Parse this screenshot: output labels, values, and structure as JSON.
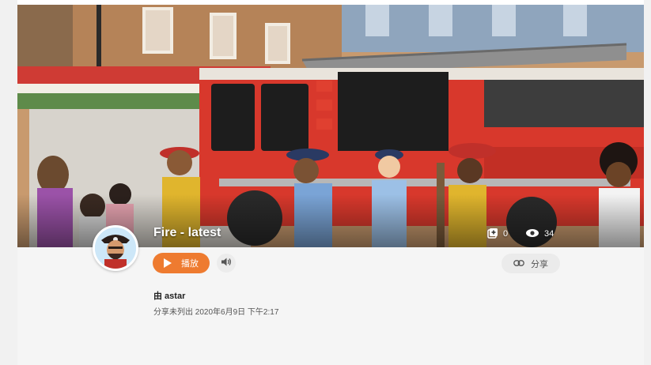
{
  "project": {
    "title": "Fire - latest",
    "remix_count": "0",
    "view_count": "34"
  },
  "actions": {
    "play_label": "播放",
    "share_label": "分享"
  },
  "meta": {
    "author_line": "由 astar",
    "shared_line": "分享未列出 2020年6月9日 下午2:17"
  },
  "icons": {
    "remix": "remix-icon",
    "views": "eye-icon",
    "play": "play-icon",
    "audio": "speaker-icon",
    "share": "link-icon"
  },
  "colors": {
    "accent": "#ee7b30",
    "panel": "#f5f5f5",
    "button_grey": "#ebebeb"
  }
}
